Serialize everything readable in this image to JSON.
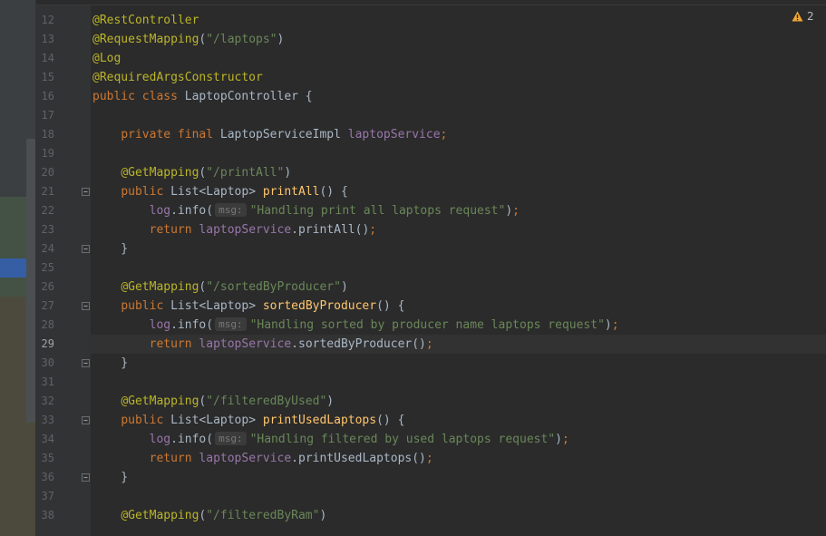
{
  "left_panel": {
    "bands": [
      {
        "color": "#3c3f41"
      },
      {
        "color": "#445245"
      },
      {
        "color": "#355ea5"
      },
      {
        "color": "#445245"
      },
      {
        "color": "#4c4a3c"
      }
    ]
  },
  "inspection_widget": {
    "icon": "warning-icon",
    "count": "2",
    "color": "#f0a732"
  },
  "editor": {
    "current_line": "29",
    "lines": [
      {
        "n": "12",
        "tokens": [
          [
            "ann",
            "@RestController"
          ]
        ]
      },
      {
        "n": "13",
        "tokens": [
          [
            "ann",
            "@RequestMapping"
          ],
          [
            "p",
            "("
          ],
          [
            "str",
            "\"/laptops\""
          ],
          [
            "p",
            ")"
          ]
        ]
      },
      {
        "n": "14",
        "tokens": [
          [
            "ann",
            "@Log"
          ]
        ]
      },
      {
        "n": "15",
        "tokens": [
          [
            "ann",
            "@RequiredArgsConstructor"
          ]
        ]
      },
      {
        "n": "16",
        "tokens": [
          [
            "kw",
            "public class "
          ],
          [
            "p",
            "LaptopController {"
          ]
        ]
      },
      {
        "n": "17",
        "tokens": []
      },
      {
        "n": "18",
        "tokens": [
          [
            "p",
            "    "
          ],
          [
            "kw",
            "private final "
          ],
          [
            "p",
            "LaptopServiceImpl "
          ],
          [
            "fld",
            "laptopService"
          ],
          [
            "kw",
            ";"
          ]
        ]
      },
      {
        "n": "19",
        "tokens": []
      },
      {
        "n": "20",
        "tokens": [
          [
            "p",
            "    "
          ],
          [
            "ann",
            "@GetMapping"
          ],
          [
            "p",
            "("
          ],
          [
            "str",
            "\"/printAll\""
          ],
          [
            "p",
            ")"
          ]
        ]
      },
      {
        "n": "21",
        "tokens": [
          [
            "p",
            "    "
          ],
          [
            "kw",
            "public "
          ],
          [
            "p",
            "List<Laptop> "
          ],
          [
            "fn",
            "printAll"
          ],
          [
            "p",
            "() {"
          ]
        ]
      },
      {
        "n": "22",
        "tokens": [
          [
            "p",
            "        "
          ],
          [
            "fld",
            "log"
          ],
          [
            "p",
            ".info("
          ],
          [
            "hint",
            "msg:"
          ],
          [
            "str",
            "\"Handling print all laptops request\""
          ],
          [
            "p",
            ")"
          ],
          [
            "kw",
            ";"
          ]
        ]
      },
      {
        "n": "23",
        "tokens": [
          [
            "p",
            "        "
          ],
          [
            "kw",
            "return "
          ],
          [
            "fld",
            "laptopService"
          ],
          [
            "p",
            ".printAll()"
          ],
          [
            "kw",
            ";"
          ]
        ]
      },
      {
        "n": "24",
        "tokens": [
          [
            "p",
            "    }"
          ]
        ]
      },
      {
        "n": "25",
        "tokens": []
      },
      {
        "n": "26",
        "tokens": [
          [
            "p",
            "    "
          ],
          [
            "ann",
            "@GetMapping"
          ],
          [
            "p",
            "("
          ],
          [
            "str",
            "\"/sortedByProducer\""
          ],
          [
            "p",
            ")"
          ]
        ]
      },
      {
        "n": "27",
        "tokens": [
          [
            "p",
            "    "
          ],
          [
            "kw",
            "public "
          ],
          [
            "p",
            "List<Laptop> "
          ],
          [
            "fn",
            "sortedByProducer"
          ],
          [
            "p",
            "() {"
          ]
        ]
      },
      {
        "n": "28",
        "tokens": [
          [
            "p",
            "        "
          ],
          [
            "fld",
            "log"
          ],
          [
            "p",
            ".info("
          ],
          [
            "hint",
            "msg:"
          ],
          [
            "str",
            "\"Handling sorted by producer name laptops request\""
          ],
          [
            "p",
            ")"
          ],
          [
            "kw",
            ";"
          ]
        ]
      },
      {
        "n": "29",
        "tokens": [
          [
            "p",
            "        "
          ],
          [
            "kw",
            "return "
          ],
          [
            "fld",
            "laptopService"
          ],
          [
            "p",
            ".sortedByProducer()"
          ],
          [
            "kw",
            ";"
          ]
        ]
      },
      {
        "n": "30",
        "tokens": [
          [
            "p",
            "    }"
          ]
        ]
      },
      {
        "n": "31",
        "tokens": []
      },
      {
        "n": "32",
        "tokens": [
          [
            "p",
            "    "
          ],
          [
            "ann",
            "@GetMapping"
          ],
          [
            "p",
            "("
          ],
          [
            "str",
            "\"/filteredByUsed\""
          ],
          [
            "p",
            ")"
          ]
        ]
      },
      {
        "n": "33",
        "tokens": [
          [
            "p",
            "    "
          ],
          [
            "kw",
            "public "
          ],
          [
            "p",
            "List<Laptop> "
          ],
          [
            "fn",
            "printUsedLaptops"
          ],
          [
            "p",
            "() {"
          ]
        ]
      },
      {
        "n": "34",
        "tokens": [
          [
            "p",
            "        "
          ],
          [
            "fld",
            "log"
          ],
          [
            "p",
            ".info("
          ],
          [
            "hint",
            "msg:"
          ],
          [
            "str",
            "\"Handling filtered by used laptops request\""
          ],
          [
            "p",
            ")"
          ],
          [
            "kw",
            ";"
          ]
        ]
      },
      {
        "n": "35",
        "tokens": [
          [
            "p",
            "        "
          ],
          [
            "kw",
            "return "
          ],
          [
            "fld",
            "laptopService"
          ],
          [
            "p",
            ".printUsedLaptops()"
          ],
          [
            "kw",
            ";"
          ]
        ]
      },
      {
        "n": "36",
        "tokens": [
          [
            "p",
            "    }"
          ]
        ]
      },
      {
        "n": "37",
        "tokens": []
      },
      {
        "n": "38",
        "tokens": [
          [
            "p",
            "    "
          ],
          [
            "ann",
            "@GetMapping"
          ],
          [
            "p",
            "("
          ],
          [
            "str",
            "\"/filteredByRam\""
          ],
          [
            "p",
            ")"
          ]
        ]
      }
    ],
    "fold_lines": [
      "21",
      "24",
      "27",
      "30",
      "33",
      "36"
    ]
  }
}
